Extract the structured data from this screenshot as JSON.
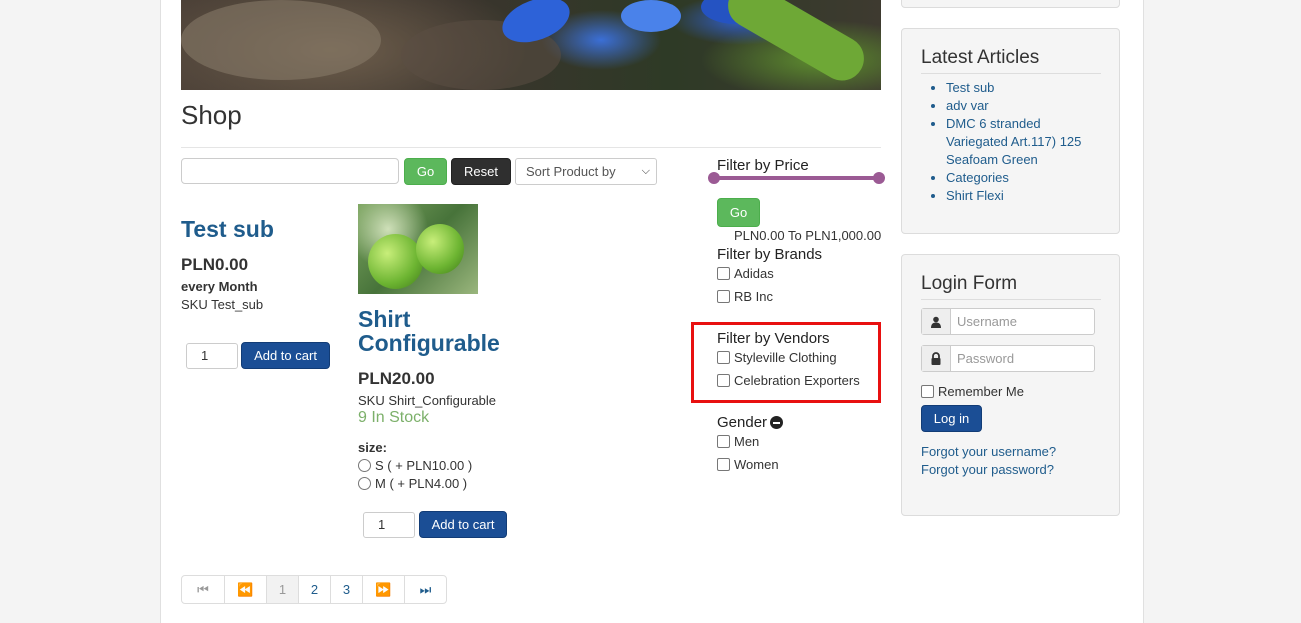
{
  "page": {
    "title": "Shop"
  },
  "toolbar": {
    "search_value": "",
    "go_label": "Go",
    "reset_label": "Reset",
    "sort_selected": "Sort Product by"
  },
  "products": [
    {
      "title": "Test sub",
      "price": "PLN0.00",
      "interval": "every Month",
      "sku": "SKU Test_sub",
      "qty": "1",
      "cart_label": "Add to cart"
    },
    {
      "title": "Shirt Configurable",
      "price": "PLN20.00",
      "sku": "SKU Shirt_Configurable",
      "stock": "9 In Stock",
      "option_label": "size:",
      "options": [
        "S ( + PLN10.00 )",
        "M ( + PLN4.00 )"
      ],
      "qty": "1",
      "cart_label": "Add to cart"
    }
  ],
  "filters": {
    "price": {
      "heading": "Filter by Price",
      "go_label": "Go",
      "range_text": "PLN0.00 To PLN1,000.00"
    },
    "brands": {
      "heading": "Filter by Brands",
      "items": [
        "Adidas",
        "RB Inc"
      ]
    },
    "vendors": {
      "heading": "Filter by Vendors",
      "items": [
        "Styleville Clothing",
        "Celebration Exporters"
      ]
    },
    "gender": {
      "heading": "Gender",
      "items": [
        "Men",
        "Women"
      ]
    }
  },
  "pagination": {
    "pages": [
      "1",
      "2",
      "3"
    ],
    "current": "1"
  },
  "sidebar": {
    "articles": {
      "heading": "Latest Articles",
      "items": [
        "Test sub",
        "adv var",
        "DMC 6 stranded Variegated Art.117) 125 Seafoam Green",
        "Categories",
        "Shirt Flexi"
      ]
    },
    "login": {
      "heading": "Login Form",
      "username_placeholder": "Username",
      "password_placeholder": "Password",
      "remember_label": "Remember Me",
      "login_label": "Log in",
      "forgot_username": "Forgot your username?",
      "forgot_password": "Forgot your password?"
    }
  },
  "colors": {
    "link": "#1f5c8c",
    "go_green": "#5cb85c",
    "cart_blue": "#1b4e95",
    "slider": "#9b5a94",
    "highlight": "#e81010"
  }
}
